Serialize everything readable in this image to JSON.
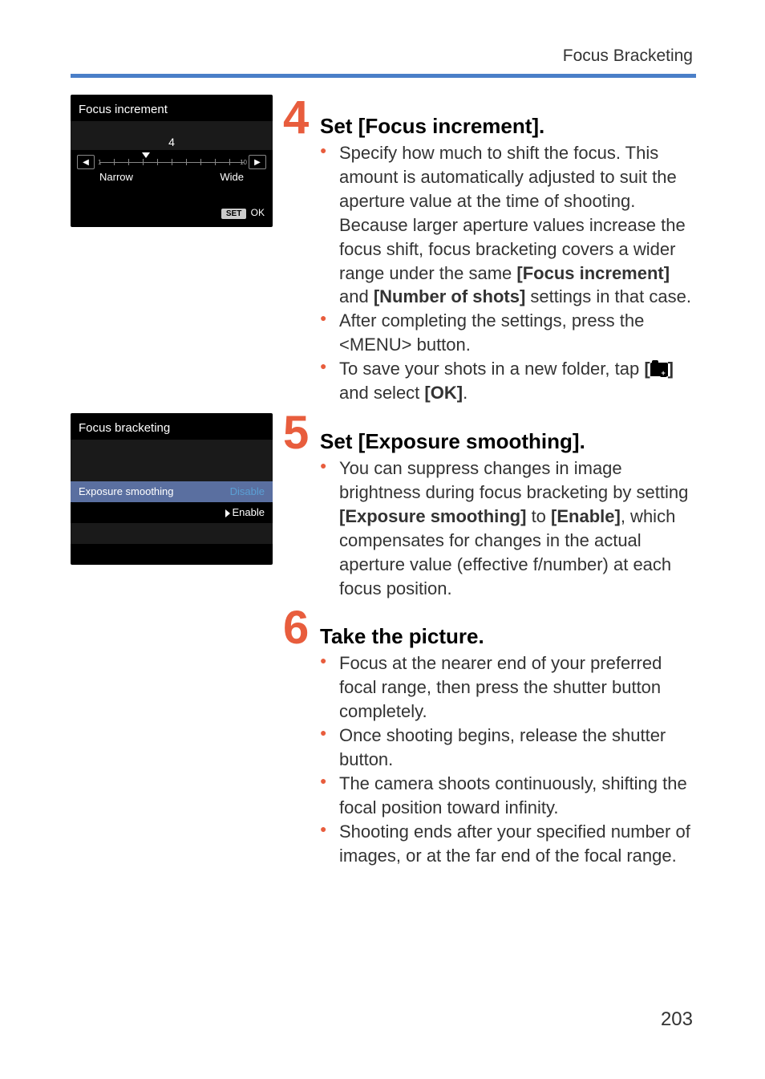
{
  "header": {
    "section": "Focus Bracketing"
  },
  "page_number": "203",
  "screenshot4": {
    "title": "Focus increment",
    "value": "4",
    "narrow": "Narrow",
    "wide": "Wide",
    "set": "SET",
    "ok": "OK"
  },
  "screenshot5": {
    "title": "Focus bracketing",
    "row_label": "Exposure smoothing",
    "disable": "Disable",
    "enable": "Enable"
  },
  "step4": {
    "num": "4",
    "title": "Set [Focus increment].",
    "b1a": "Specify how much to shift the focus. This amount is automatically adjusted to suit the aperture value at the time of shooting.",
    "b1b": "Because larger aperture values increase the focus shift, focus bracketing covers a wider range under the same ",
    "b1b_bold1": "[Focus increment]",
    "b1b_mid": " and ",
    "b1b_bold2": "[Number of shots]",
    "b1b_end": " settings in that case.",
    "b2a": "After completing the settings, press the <",
    "b2_menu": "MENU",
    "b2b": "> button.",
    "b3a": "To save your shots in a new folder, tap ",
    "b3_open": "[",
    "b3_close": "]",
    "b3b": " and select ",
    "b3_ok": "[OK]",
    "b3c": "."
  },
  "step5": {
    "num": "5",
    "title": "Set [Exposure smoothing].",
    "b1a": "You can suppress changes in image brightness during focus bracketing by setting ",
    "b1_bold1": "[Exposure smoothing]",
    "b1b": " to ",
    "b1_bold2": "[Enable]",
    "b1c": ", which compensates for changes in the actual aperture value (effective f/number) at each focus position."
  },
  "step6": {
    "num": "6",
    "title": "Take the picture.",
    "b1": "Focus at the nearer end of your preferred focal range, then press the shutter button completely.",
    "b2": "Once shooting begins, release the shutter button.",
    "b3": "The camera shoots continuously, shifting the focal position toward infinity.",
    "b4": "Shooting ends after your specified number of images, or at the far end of the focal range."
  }
}
